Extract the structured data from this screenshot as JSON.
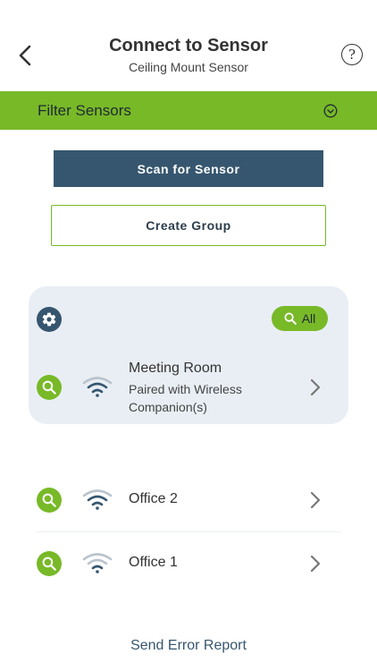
{
  "header": {
    "title": "Connect to Sensor",
    "subtitle": "Ceiling Mount Sensor",
    "help_symbol": "?"
  },
  "filter": {
    "label": "Filter Sensors",
    "icon": "chevron-down-circle-icon"
  },
  "actions": {
    "scan_label": "Scan for Sensor",
    "create_group_label": "Create Group"
  },
  "group": {
    "all_label": "All",
    "item": {
      "name": "Meeting Room",
      "status_line1": "Paired with Wireless",
      "status_line2": "Companion(s)"
    }
  },
  "sensors": [
    {
      "name": "Office 2"
    },
    {
      "name": "Office 1"
    }
  ],
  "footer": {
    "error_report_label": "Send Error Report"
  },
  "colors": {
    "accent_green": "#78b928",
    "navy": "#36566f",
    "card_bg": "#e9eef4"
  }
}
